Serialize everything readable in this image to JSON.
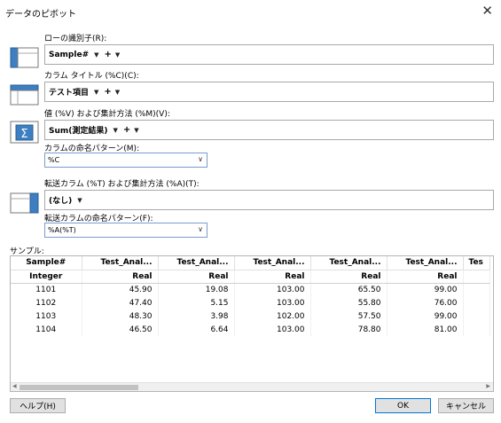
{
  "window": {
    "title": "データのピボット",
    "close_label": "✕"
  },
  "sections": [
    {
      "label": "ローの識別子(R):",
      "token": "Sample#"
    },
    {
      "label": "カラム タイトル (%C)(C):",
      "token": "テスト項目"
    },
    {
      "label": "値 (%V) および集計方法 (%M)(V):",
      "token": "Sum(測定結果)"
    },
    {
      "label": "転送カラム (%T) および集計方法 (%A)(T):",
      "token": "(なし)"
    }
  ],
  "naming": {
    "label": "カラムの命名パターン(M):",
    "value": "%C"
  },
  "transfer_naming": {
    "label": "転送カラムの命名パターン(F):",
    "value": "%A(%T)"
  },
  "sample": {
    "label": "サンプル:",
    "headers": [
      "Sample#",
      "Test_Anal...",
      "Test_Anal...",
      "Test_Anal...",
      "Test_Anal...",
      "Test_Anal...",
      "Tes"
    ],
    "types": [
      "Integer",
      "Real",
      "Real",
      "Real",
      "Real",
      "Real",
      ""
    ],
    "rows": [
      [
        "1101",
        "45.90",
        "19.08",
        "103.00",
        "65.50",
        "99.00",
        ""
      ],
      [
        "1102",
        "47.40",
        "5.15",
        "103.00",
        "55.80",
        "76.00",
        ""
      ],
      [
        "1103",
        "48.30",
        "3.98",
        "102.00",
        "57.50",
        "99.00",
        ""
      ],
      [
        "1104",
        "46.50",
        "6.64",
        "103.00",
        "78.80",
        "81.00",
        ""
      ]
    ]
  },
  "buttons": {
    "help": "ヘルプ(H)",
    "ok": "OK",
    "cancel": "キャンセル"
  },
  "colors": {
    "focus_border": "#0078d7",
    "icon_blue": "#2b6cb0"
  }
}
